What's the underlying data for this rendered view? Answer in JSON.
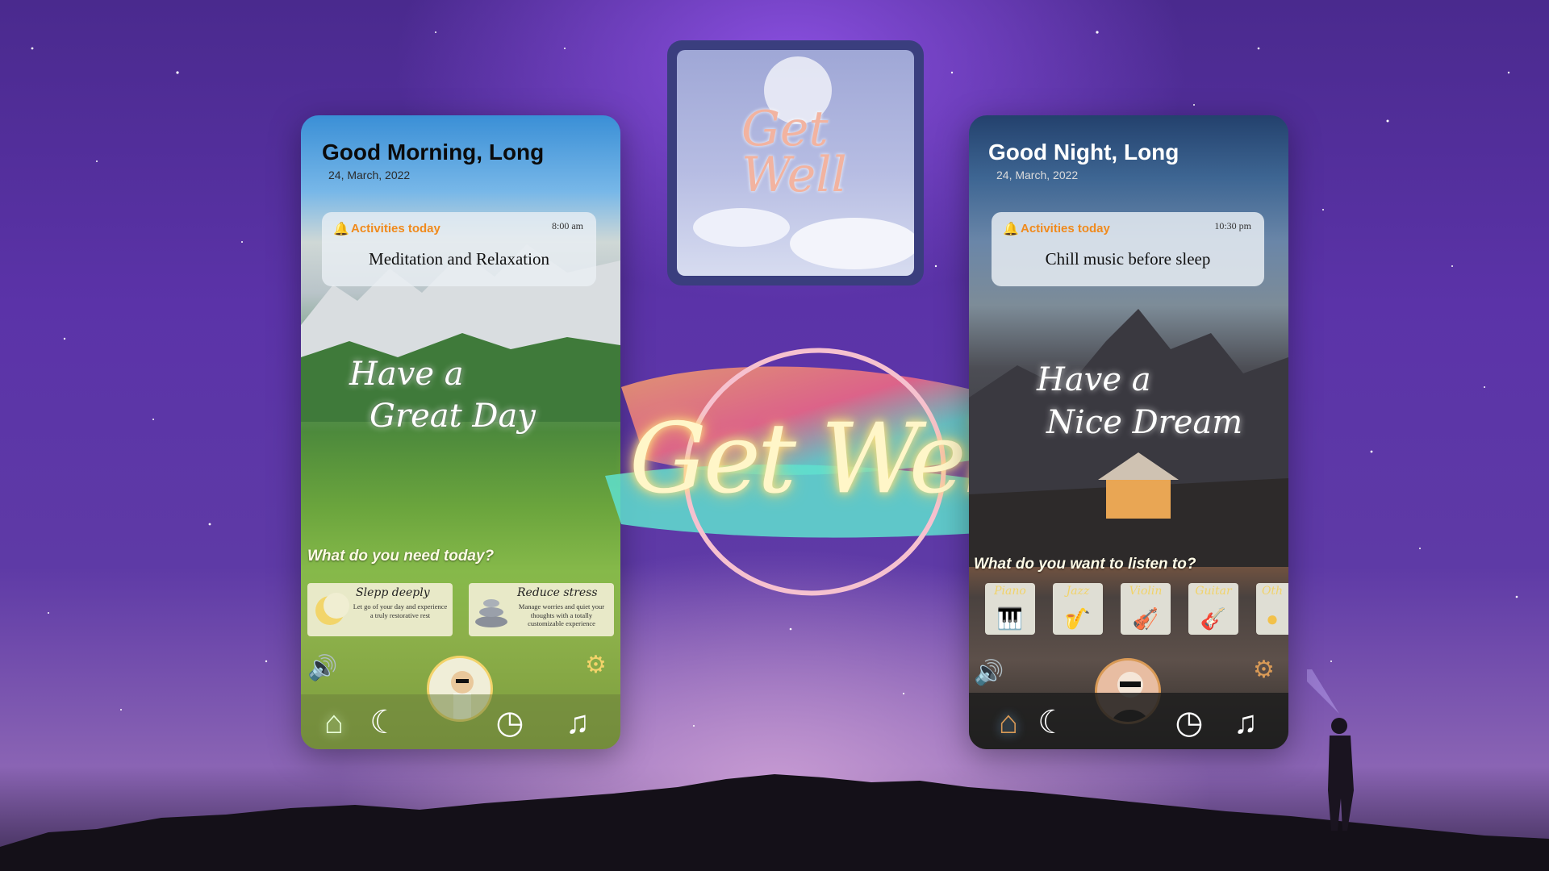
{
  "center_logo": {
    "text": "Get Well"
  },
  "logo_card": {
    "text": "Get Well"
  },
  "day_screen": {
    "greeting": "Good Morning, Long",
    "date": "24, March, 2022",
    "activity_label": "Activities today",
    "activity_time": "8:00 am",
    "activity_title": "Meditation and Relaxation",
    "tagline_line1": "Have a",
    "tagline_line2": "Great Day",
    "section_question": "What do you need today?",
    "cards": [
      {
        "title": "Slepp deeply",
        "desc": "Let go of your day and experience a truly restorative rest"
      },
      {
        "title": "Reduce stress",
        "desc": "Manage worries and quiet your thoughts with a totally customizable experience"
      }
    ],
    "icons": {
      "volume": "speaker-icon",
      "settings": "gear-icon",
      "home": "home-icon",
      "sleep": "moon-icon",
      "timer": "clock-icon",
      "music": "music-note-icon"
    },
    "accent": "#f3d36a"
  },
  "night_screen": {
    "greeting": "Good Night, Long",
    "date": "24, March, 2022",
    "activity_label": "Activities today",
    "activity_time": "10:30 pm",
    "activity_title": "Chill music before sleep",
    "tagline_line1": "Have a",
    "tagline_line2": "Nice Dream",
    "section_question": "What do you want to listen to?",
    "music": [
      {
        "name": "Piano",
        "icon": "piano-icon"
      },
      {
        "name": "Jazz",
        "icon": "saxophone-icon"
      },
      {
        "name": "Violin",
        "icon": "violin-icon"
      },
      {
        "name": "Guitar",
        "icon": "guitar-icon"
      },
      {
        "name": "Oth",
        "icon": "other-icon"
      }
    ],
    "icons": {
      "volume": "speaker-icon",
      "settings": "gear-icon",
      "home": "home-icon",
      "sleep": "moon-icon",
      "timer": "clock-icon",
      "music": "music-note-icon"
    },
    "accent": "#d99a56"
  }
}
